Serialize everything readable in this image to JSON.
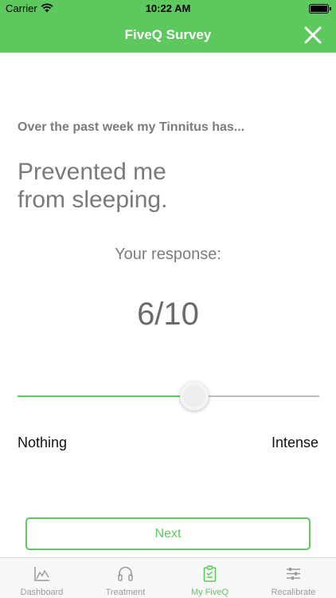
{
  "status_bar": {
    "carrier": "Carrier",
    "time": "10:22 AM",
    "wifi_icon": "wifi-icon",
    "battery_icon": "battery-icon"
  },
  "nav": {
    "title": "FiveQ Survey",
    "close_icon": "close-icon"
  },
  "survey": {
    "prompt": "Over the past week my Tinnitus has...",
    "question_lines": [
      "Prevented me",
      "from sleeping."
    ],
    "response_label": "Your response:",
    "response_value": "6/10",
    "slider": {
      "value": 6,
      "max": 10,
      "fraction": 0.585,
      "min_label": "Nothing",
      "max_label": "Intense"
    },
    "next_label": "Next"
  },
  "tabs": [
    {
      "label": "Dashboard",
      "icon": "chart-area-icon",
      "active": false
    },
    {
      "label": "Treatment",
      "icon": "headphones-icon",
      "active": false
    },
    {
      "label": "My FiveQ",
      "icon": "clipboard-icon",
      "active": true
    },
    {
      "label": "Recalibrate",
      "icon": "sliders-icon",
      "active": false
    }
  ],
  "colors": {
    "accent": "#5cc85e",
    "text_gray": "#7c7c7c",
    "tab_inactive": "#9a9a9a"
  }
}
